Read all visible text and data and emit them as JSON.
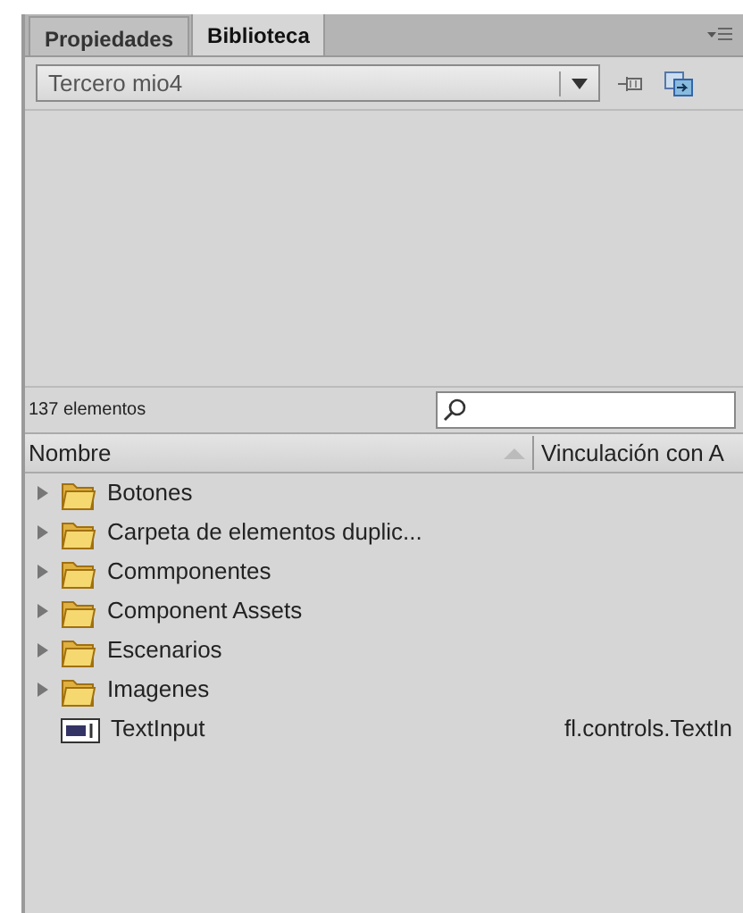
{
  "tabs": [
    {
      "label": "Propiedades",
      "selected": false
    },
    {
      "label": "Biblioteca",
      "selected": true
    }
  ],
  "library_select": {
    "value": "Tercero mio4"
  },
  "item_count": "137 elementos",
  "columns": [
    "Nombre",
    "Vinculación con A"
  ],
  "items": [
    {
      "name": "Botones",
      "kind": "folder",
      "expanded": false
    },
    {
      "name": "Carpeta de elementos duplic...",
      "kind": "folder",
      "expanded": false
    },
    {
      "name": "Commponentes",
      "kind": "folder",
      "expanded": false
    },
    {
      "name": "Component Assets",
      "kind": "folder",
      "expanded": false
    },
    {
      "name": "Escenarios",
      "kind": "folder",
      "expanded": false
    },
    {
      "name": "Imagenes",
      "kind": "folder",
      "expanded": false
    },
    {
      "name": "TextInput",
      "kind": "component",
      "linkage": "fl.controls.TextIn"
    }
  ]
}
